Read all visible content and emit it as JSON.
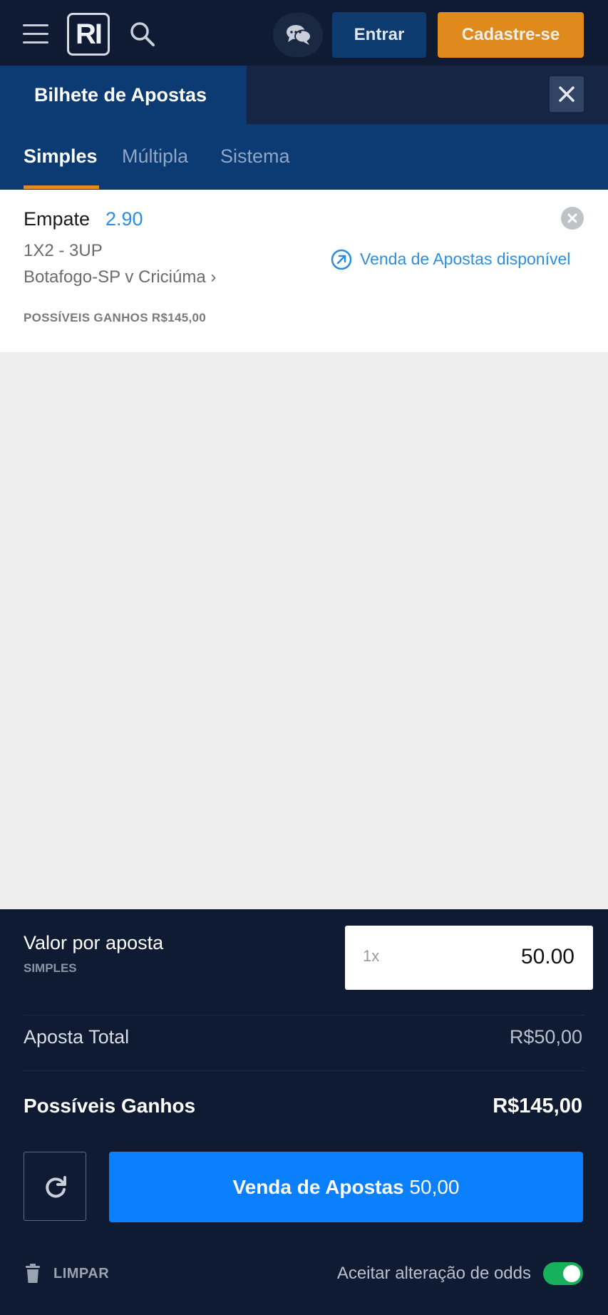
{
  "header": {
    "logo_text": "RI",
    "login_label": "Entrar",
    "signup_label": "Cadastre-se"
  },
  "betslip": {
    "title": "Bilhete de Apostas",
    "tabs": [
      {
        "label": "Simples",
        "active": true
      },
      {
        "label": "Múltipla",
        "active": false
      },
      {
        "label": "Sistema",
        "active": false
      }
    ]
  },
  "bet": {
    "selection": "Empate",
    "odds": "2.90",
    "market": "1X2 - 3UP",
    "event": "Botafogo-SP v Criciúma",
    "event_chevron": "›",
    "possible_gains": "POSSÍVEIS GANHOS R$145,00",
    "cashout_text": "Venda de Apostas disponível"
  },
  "footer": {
    "stake_label": "Valor por aposta",
    "stake_sub": "SIMPLES",
    "stake_multiplier": "1x",
    "stake_value": "50.00",
    "total_label": "Aposta Total",
    "total_value": "R$50,00",
    "gains_label": "Possíveis Ganhos",
    "gains_value": "R$145,00",
    "place_label": "Venda de Apostas",
    "place_amount": "50,00",
    "clear_label": "LIMPAR",
    "accept_odds_label": "Aceitar alteração de odds",
    "accept_odds_enabled": true
  },
  "colors": {
    "accent_orange": "#e08a1e",
    "accent_blue": "#0a80ff",
    "odds_blue": "#2b8fe0",
    "toggle_green": "#18b15b"
  }
}
